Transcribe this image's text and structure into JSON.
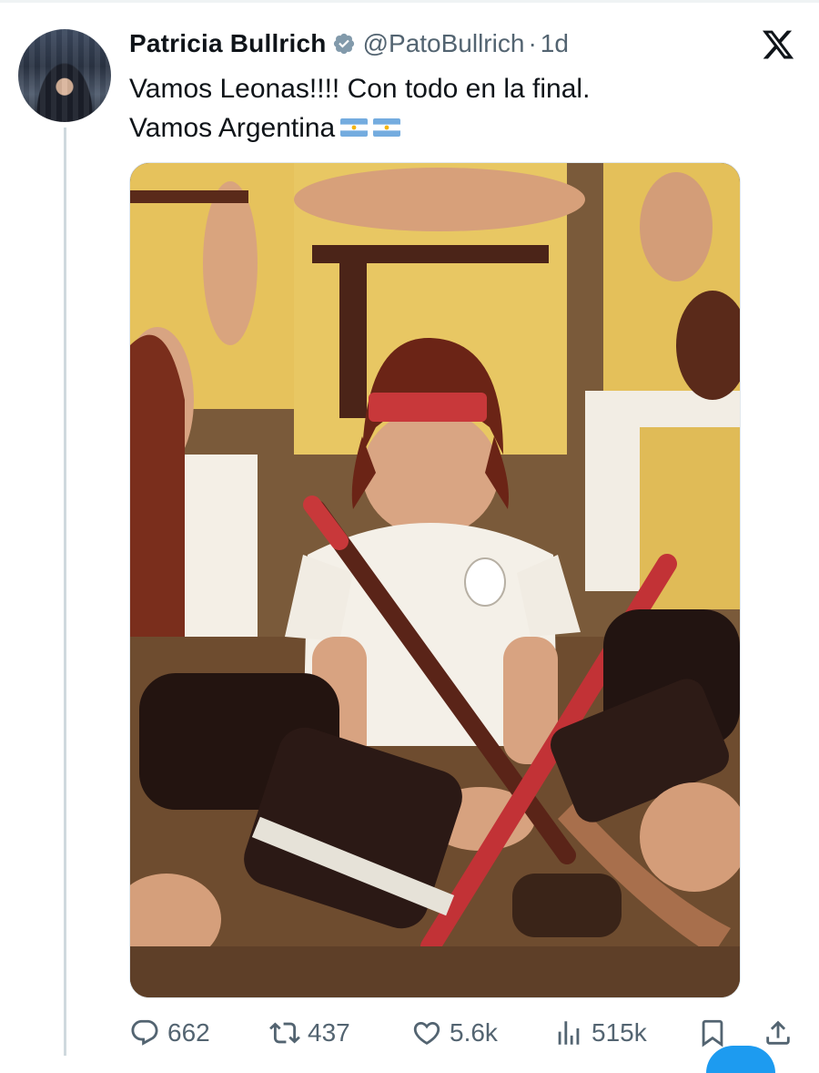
{
  "tweet": {
    "author": {
      "display_name": "Patricia Bullrich",
      "handle": "@PatoBullrich",
      "verified_icon": "verified-badge-icon",
      "avatar": "profile-photo"
    },
    "separator": "·",
    "time": "1d",
    "text_line_1": "Vamos Leonas!!!! Con todo en la final.",
    "text_line_2": "Vamos Argentina",
    "text_emoji": [
      "argentina-flag",
      "argentina-flag"
    ],
    "media": {
      "type": "photo",
      "subject": "vintage field hockey team photo"
    }
  },
  "actions": {
    "reply": {
      "icon": "reply-icon",
      "count": "662"
    },
    "retweet": {
      "icon": "retweet-icon",
      "count": "437"
    },
    "like": {
      "icon": "heart-icon",
      "count": "5.6k"
    },
    "views": {
      "icon": "views-icon",
      "count": "515k"
    },
    "bookmark": {
      "icon": "bookmark-icon"
    },
    "share": {
      "icon": "share-icon"
    }
  },
  "brand": {
    "logo": "x-logo-icon"
  },
  "colors": {
    "text_primary": "#0f1419",
    "text_secondary": "#536471",
    "verified": "#829aab",
    "accent": "#1d9bf0",
    "thread_line": "#cfd9de"
  }
}
